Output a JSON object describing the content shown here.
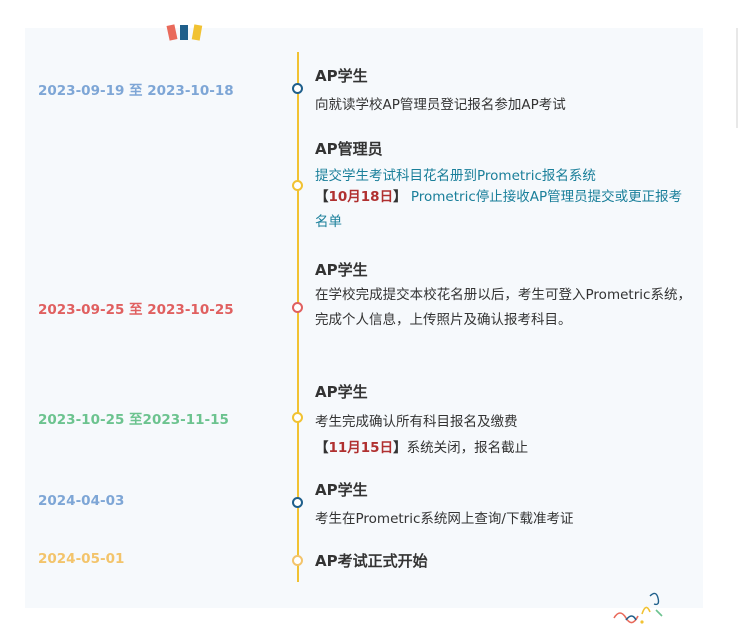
{
  "entries": [
    {
      "date": "2023-09-19 至 2023-10-18",
      "date_color": "#7ea6d6",
      "dot_color": "#1f5f8b",
      "title": "AP学生",
      "lines": [
        "向就读学校AP管理员登记报名参加AP考试"
      ]
    },
    {
      "date": "",
      "dot_color": "#f1c232",
      "title": "AP管理员",
      "line1": "提交学生考试科目花名册到Prometric报名系统",
      "bracket_open": "【",
      "highlight": "10月18日",
      "bracket_close": "】",
      "rest": " Prometric停止接收AP管理员提交或更正报考名单"
    },
    {
      "date": "2023-09-25 至 2023-10-25",
      "date_color": "#e06060",
      "dot_color": "#e06060",
      "title": "AP学生",
      "paragraph": "在学校完成提交本校花名册以后，考生可登入Prometric系统，完成个人信息，上传照片及确认报考科目。"
    },
    {
      "date": "2023-10-25 至2023-11-15",
      "date_color": "#6cc38f",
      "dot_color": "#f1c232",
      "title": "AP学生",
      "line1": "考生完成确认所有科目报名及缴费",
      "bracket_open": "【",
      "highlight": "11月15日",
      "bracket_close": "】",
      "rest": "系统关闭，报名截止"
    },
    {
      "date": "2024-04-03",
      "date_color": "#7ea6d6",
      "dot_color": "#1f5f8b",
      "title": "AP学生",
      "line1": "考生在Prometric系统网上查询/下载准考证"
    },
    {
      "date": "2024-05-01",
      "date_color": "#f3c46b",
      "dot_color": "#f3c46b",
      "title": "AP考试正式开始"
    }
  ],
  "colors": {
    "line": "#f1c232",
    "card_bg": "#f6f9fc",
    "highlight": "#b03030"
  }
}
